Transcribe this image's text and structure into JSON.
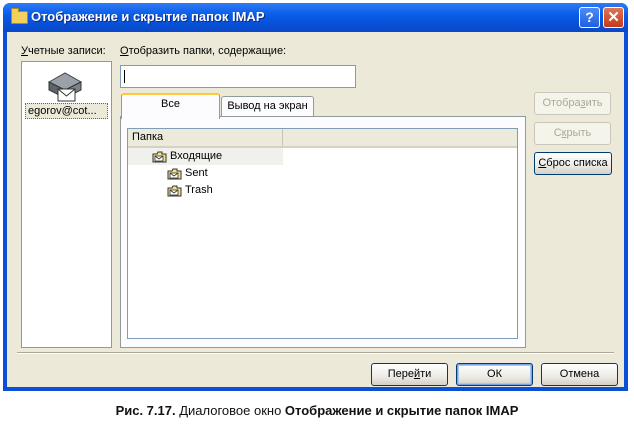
{
  "window": {
    "title": "Отображение и скрытие папок IMAP",
    "help_label": "?",
    "close_label": "✕"
  },
  "accounts": {
    "label_first": "У",
    "label_rest": "четные записи:",
    "items": [
      {
        "name": "egorov@cot..."
      }
    ]
  },
  "filter": {
    "label_first": "О",
    "label_rest": "тобразить папки, содержащие:",
    "value": ""
  },
  "tabs": [
    {
      "label": "Все",
      "active": true
    },
    {
      "label": "Вывод на экран",
      "active": false
    }
  ],
  "folder_table": {
    "header": "Папка",
    "rows": [
      {
        "name": "Входящие",
        "level": 0
      },
      {
        "name": "Sent",
        "level": 1
      },
      {
        "name": "Trash",
        "level": 1
      }
    ]
  },
  "side_buttons": {
    "show": {
      "pre": "Отобра",
      "u": "з",
      "post": "ить"
    },
    "hide": {
      "pre": "С",
      "u": "к",
      "post": "рыть"
    },
    "reset": {
      "pre": "",
      "u": "С",
      "post": "брос списка"
    }
  },
  "bottom_buttons": {
    "goto": {
      "pre": "Пере",
      "u": "й",
      "post": "ти"
    },
    "ok": "ОК",
    "cancel": "Отмена"
  },
  "caption": {
    "prefix": "Рис. 7.17.",
    "middle": " Диалоговое окно ",
    "bold": "Отображение и скрытие папок IMAP"
  },
  "colors": {
    "titlebar": "#0a5ce8",
    "dialog_bg": "#ece9d8",
    "tab_highlight": "#ffc83c"
  }
}
